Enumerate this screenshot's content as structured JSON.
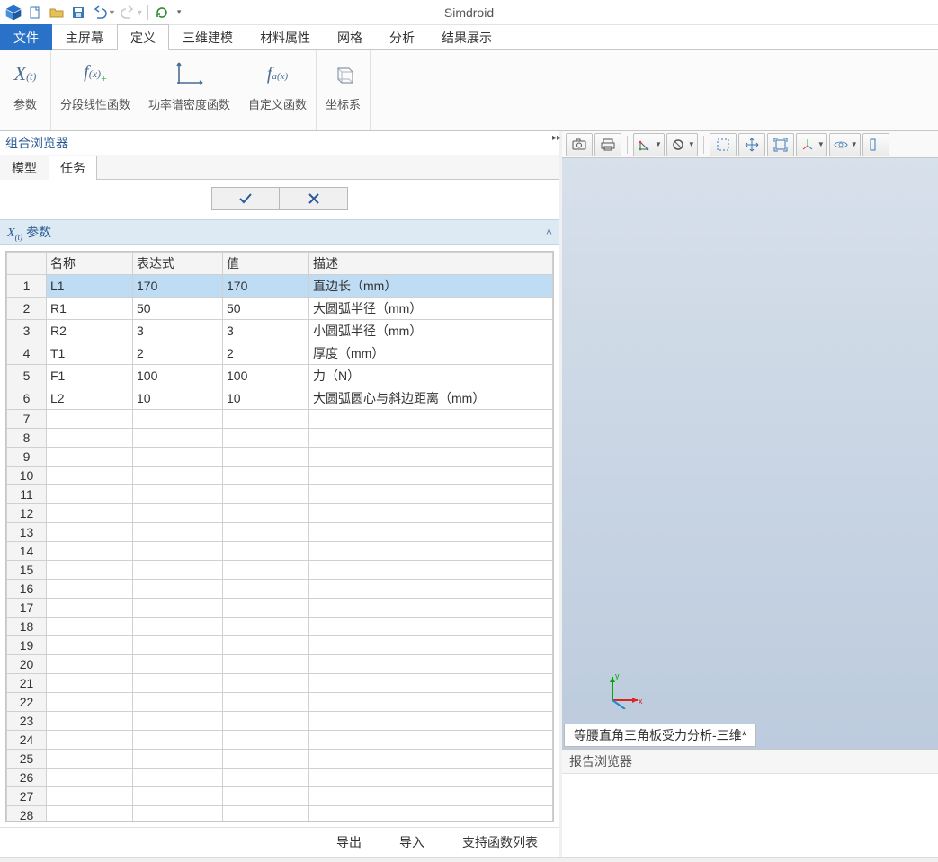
{
  "app_name": "Simdroid",
  "ribbon": {
    "file": "文件",
    "tabs": [
      "主屏幕",
      "定义",
      "三维建模",
      "材料属性",
      "网格",
      "分析",
      "结果展示"
    ],
    "active_tab_index": 1,
    "buttons": {
      "params": "参数",
      "piecewise": "分段线性函数",
      "psd": "功率谱密度函数",
      "custom_fn": "自定义函数",
      "coord_sys": "坐标系"
    }
  },
  "left_panel": {
    "title": "组合浏览器",
    "tabs": {
      "model": "模型",
      "task": "任务"
    },
    "active_tab": "task",
    "section_title": "参数",
    "columns": {
      "name": "名称",
      "expr": "表达式",
      "value": "值",
      "desc": "描述"
    },
    "rows": [
      {
        "name": "L1",
        "expr": "170",
        "value": "170",
        "desc": "直边长（mm）",
        "selected": true
      },
      {
        "name": "R1",
        "expr": "50",
        "value": "50",
        "desc": "大圆弧半径（mm）"
      },
      {
        "name": "R2",
        "expr": "3",
        "value": "3",
        "desc": "小圆弧半径（mm）"
      },
      {
        "name": "T1",
        "expr": "2",
        "value": "2",
        "desc": "厚度（mm）"
      },
      {
        "name": "F1",
        "expr": "100",
        "value": "100",
        "desc": "力（N）"
      },
      {
        "name": "L2",
        "expr": "10",
        "value": "10",
        "desc": "大圆弧圆心与斜边距离（mm）"
      }
    ],
    "total_rows": 28,
    "footer": {
      "export": "导出",
      "import": "导入",
      "fn_list": "支持函数列表"
    }
  },
  "viewport": {
    "tab_label": "等腰直角三角板受力分析-三维*"
  },
  "report": {
    "title": "报告浏览器"
  }
}
